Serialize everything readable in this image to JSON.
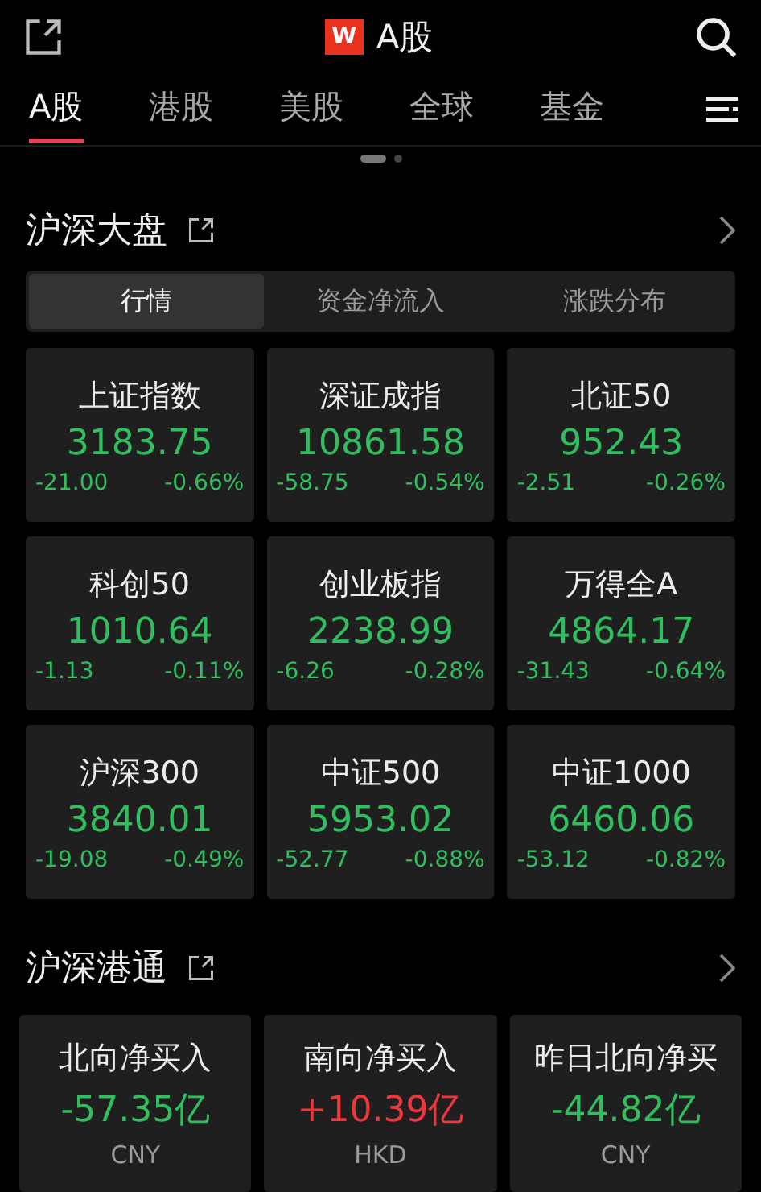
{
  "header": {
    "logo": "W",
    "title": "A股"
  },
  "tabs": [
    {
      "label": "A股",
      "selected": true
    },
    {
      "label": "港股",
      "selected": false
    },
    {
      "label": "美股",
      "selected": false
    },
    {
      "label": "全球",
      "selected": false
    },
    {
      "label": "基金",
      "selected": false
    }
  ],
  "pager": [
    {
      "selected": true
    },
    {
      "selected": false
    }
  ],
  "market_section": {
    "title": "沪深大盘",
    "segments": [
      {
        "label": "行情",
        "selected": true
      },
      {
        "label": "资金净流入",
        "selected": false
      },
      {
        "label": "涨跌分布",
        "selected": false
      }
    ],
    "indices": [
      {
        "name": "上证指数",
        "value": "3183.75",
        "change": "-21.00",
        "percent": "-0.66%",
        "color": "#2fbf5f"
      },
      {
        "name": "深证成指",
        "value": "10861.58",
        "change": "-58.75",
        "percent": "-0.54%",
        "color": "#2fbf5f"
      },
      {
        "name": "北证50",
        "value": "952.43",
        "change": "-2.51",
        "percent": "-0.26%",
        "color": "#2fbf5f"
      },
      {
        "name": "科创50",
        "value": "1010.64",
        "change": "-1.13",
        "percent": "-0.11%",
        "color": "#2fbf5f"
      },
      {
        "name": "创业板指",
        "value": "2238.99",
        "change": "-6.26",
        "percent": "-0.28%",
        "color": "#2fbf5f"
      },
      {
        "name": "万得全A",
        "value": "4864.17",
        "change": "-31.43",
        "percent": "-0.64%",
        "color": "#2fbf5f"
      },
      {
        "name": "沪深300",
        "value": "3840.01",
        "change": "-19.08",
        "percent": "-0.49%",
        "color": "#2fbf5f"
      },
      {
        "name": "中证500",
        "value": "5953.02",
        "change": "-52.77",
        "percent": "-0.88%",
        "color": "#2fbf5f"
      },
      {
        "name": "中证1000",
        "value": "6460.06",
        "change": "-53.12",
        "percent": "-0.82%",
        "color": "#2fbf5f"
      }
    ]
  },
  "connect_section": {
    "title": "沪深港通",
    "flows": [
      {
        "name": "北向净买入",
        "value": "-57.35亿",
        "currency": "CNY",
        "color": "#2fbf5f"
      },
      {
        "name": "南向净买入",
        "value": "+10.39亿",
        "currency": "HKD",
        "color": "#f0353c"
      },
      {
        "name": "昨日北向净买",
        "value": "-44.82亿",
        "currency": "CNY",
        "color": "#2fbf5f"
      }
    ]
  }
}
